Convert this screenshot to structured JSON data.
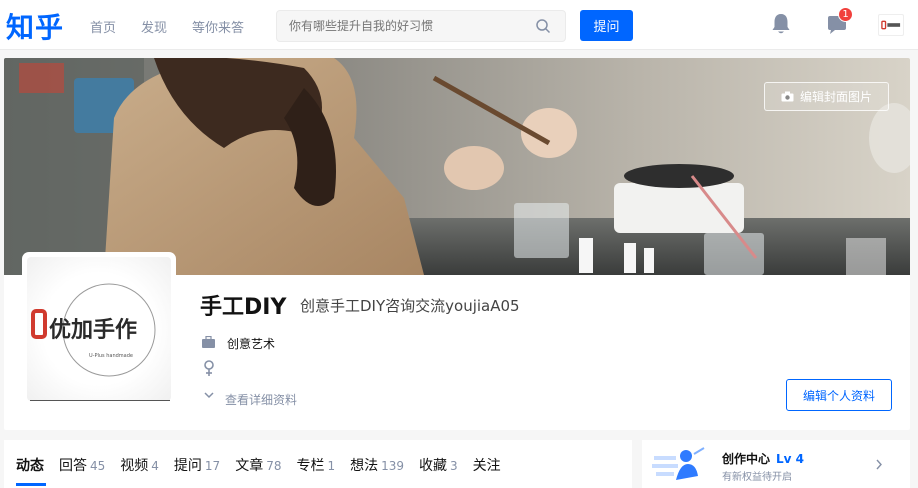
{
  "header": {
    "logo": "知乎",
    "nav": [
      "首页",
      "发现",
      "等你来答"
    ],
    "search_placeholder": "你有哪些提升自我的好习惯",
    "ask_label": "提问",
    "message_badge": "1"
  },
  "profile": {
    "cover_button_label": "编辑封面图片",
    "name": "手工DIY",
    "headline": "创意手工DIY咨询交流youjiaA05",
    "industry": "创意艺术",
    "details_label": "查看详细资料",
    "edit_button_label": "编辑个人资料",
    "avatar_logo_text": "优加手作",
    "avatar_logo_sub": "U-Plus handmade"
  },
  "tabs": [
    {
      "label": "动态",
      "count": ""
    },
    {
      "label": "回答",
      "count": "45"
    },
    {
      "label": "视频",
      "count": "4"
    },
    {
      "label": "提问",
      "count": "17"
    },
    {
      "label": "文章",
      "count": "78"
    },
    {
      "label": "专栏",
      "count": "1"
    },
    {
      "label": "想法",
      "count": "139"
    },
    {
      "label": "收藏",
      "count": "3"
    },
    {
      "label": "关注",
      "count": ""
    }
  ],
  "creator": {
    "title": "创作中心",
    "level": "Lv 4",
    "subtitle": "有新权益待开启"
  },
  "colors": {
    "brand_blue": "#0066ff",
    "badge_red": "#f1403c",
    "muted_text": "#8590a6"
  }
}
